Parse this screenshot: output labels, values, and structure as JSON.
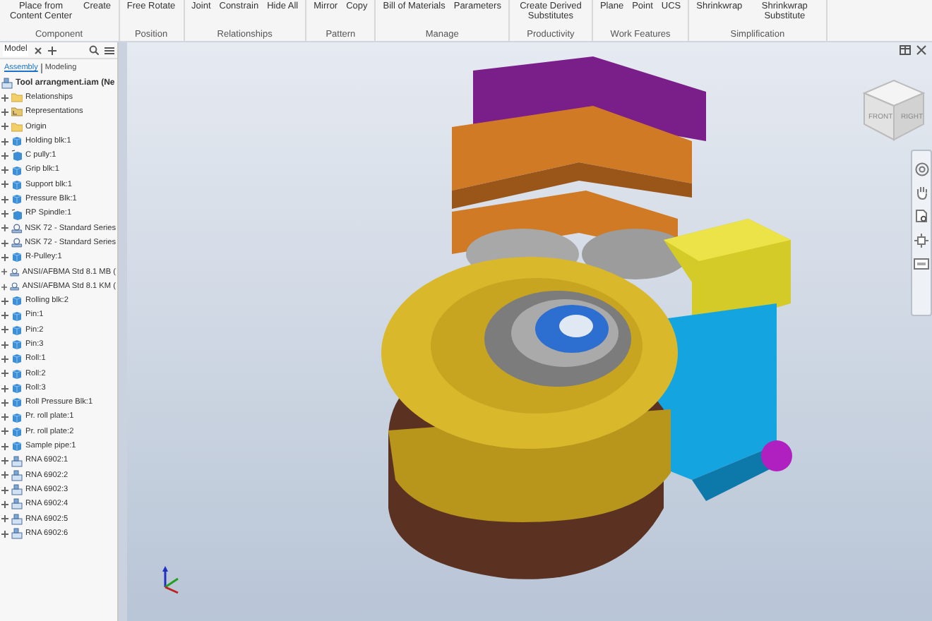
{
  "ribbon": {
    "groups": [
      {
        "label": "Component",
        "buttons": [
          "Place from Content Center",
          "Create"
        ]
      },
      {
        "label": "Position",
        "buttons": [
          "Free Rotate"
        ]
      },
      {
        "label": "Relationships",
        "buttons": [
          "Joint",
          "Constrain",
          "Hide All"
        ]
      },
      {
        "label": "Pattern",
        "buttons": [
          "Mirror",
          "Copy"
        ]
      },
      {
        "label": "Manage",
        "buttons": [
          "Bill of Materials",
          "Parameters"
        ]
      },
      {
        "label": "Productivity",
        "buttons": [
          "Create Derived Substitutes"
        ]
      },
      {
        "label": "Work Features",
        "buttons": [
          "Plane",
          "Point",
          "UCS"
        ]
      },
      {
        "label": "Simplification",
        "buttons": [
          "Shrinkwrap",
          "Shrinkwrap Substitute"
        ]
      }
    ]
  },
  "browser": {
    "tab": "Model",
    "subtabs": [
      {
        "label": "Assembly",
        "selected": true
      },
      {
        "label": "Modeling",
        "selected": false
      }
    ],
    "root": {
      "label": "Tool arrangment.iam (Ne",
      "children": [
        {
          "label": "Relationships",
          "kind": "folder",
          "expanded": false
        },
        {
          "label": "Representations",
          "kind": "reps",
          "expanded": false
        },
        {
          "label": "Origin",
          "kind": "folder",
          "expanded": false
        },
        {
          "label": "Holding blk:1",
          "kind": "part",
          "expanded": false
        },
        {
          "label": "C pully:1",
          "kind": "part-linked",
          "expanded": false
        },
        {
          "label": "Grip blk:1",
          "kind": "part",
          "expanded": false
        },
        {
          "label": "Support blk:1",
          "kind": "part",
          "expanded": false
        },
        {
          "label": "Pressure Blk:1",
          "kind": "part",
          "expanded": false
        },
        {
          "label": "RP Spindle:1",
          "kind": "part-linked",
          "expanded": false
        },
        {
          "label": "NSK 72 - Standard Series",
          "kind": "library",
          "expanded": false
        },
        {
          "label": "NSK 72 - Standard Series",
          "kind": "library",
          "expanded": false
        },
        {
          "label": "R-Pulley:1",
          "kind": "part",
          "expanded": false
        },
        {
          "label": "ANSI/AFBMA Std 8.1 MB (",
          "kind": "library",
          "expanded": false
        },
        {
          "label": "ANSI/AFBMA Std 8.1 KM (",
          "kind": "library",
          "expanded": false
        },
        {
          "label": "Rolling blk:2",
          "kind": "part",
          "expanded": false
        },
        {
          "label": "Pin:1",
          "kind": "part",
          "expanded": false
        },
        {
          "label": "Pin:2",
          "kind": "part",
          "expanded": false
        },
        {
          "label": "Pin:3",
          "kind": "part",
          "expanded": false
        },
        {
          "label": "Roll:1",
          "kind": "part",
          "expanded": false
        },
        {
          "label": "Roll:2",
          "kind": "part",
          "expanded": false
        },
        {
          "label": "Roll:3",
          "kind": "part",
          "expanded": false
        },
        {
          "label": "Roll Pressure Blk:1",
          "kind": "part",
          "expanded": false
        },
        {
          "label": "Pr. roll plate:1",
          "kind": "part",
          "expanded": false
        },
        {
          "label": "Pr. roll plate:2",
          "kind": "part",
          "expanded": false
        },
        {
          "label": "Sample pipe:1",
          "kind": "part",
          "expanded": false
        },
        {
          "label": "RNA 6902:1",
          "kind": "assembly",
          "expanded": false
        },
        {
          "label": "RNA 6902:2",
          "kind": "assembly",
          "expanded": false
        },
        {
          "label": "RNA 6902:3",
          "kind": "assembly",
          "expanded": false
        },
        {
          "label": "RNA 6902:4",
          "kind": "assembly",
          "expanded": false
        },
        {
          "label": "RNA 6902:5",
          "kind": "assembly",
          "expanded": false
        },
        {
          "label": "RNA 6902:6",
          "kind": "assembly",
          "expanded": false
        }
      ]
    }
  },
  "viewcube": {
    "faces": [
      "FRONT",
      "RIGHT"
    ]
  }
}
